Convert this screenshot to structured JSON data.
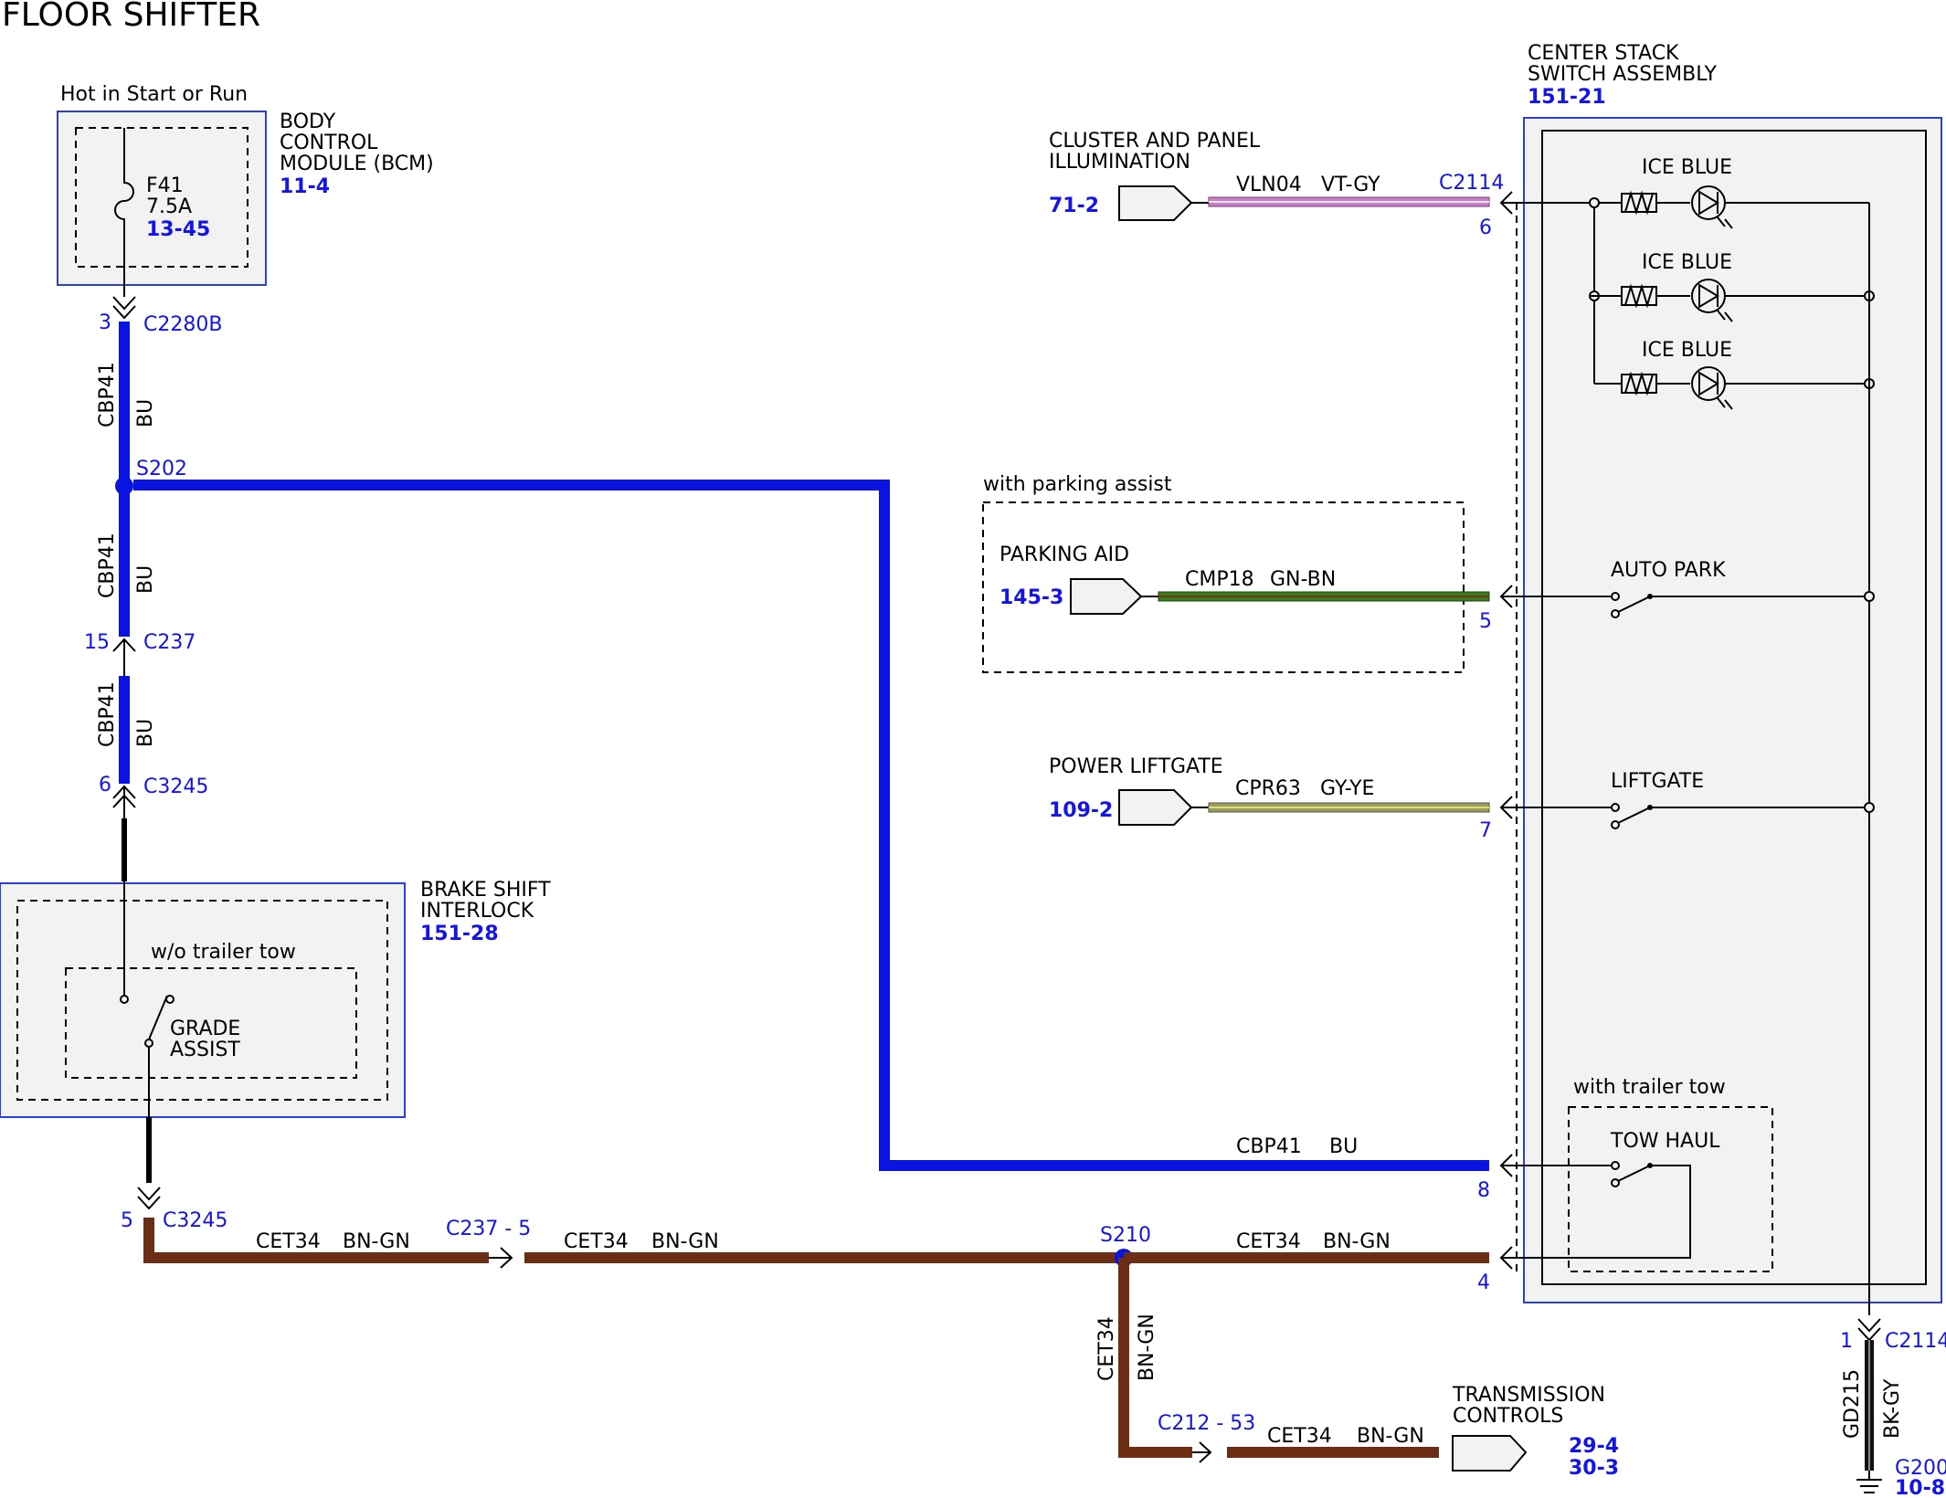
{
  "title": "FLOOR SHIFTER",
  "bcm": {
    "power_label": "Hot in Start or Run",
    "name_line1": "BODY",
    "name_line2": "CONTROL",
    "name_line3": "MODULE (BCM)",
    "ref": "11-4",
    "fuse": "F41",
    "fuse_rating": "7.5A",
    "fuse_ref": "13-45"
  },
  "connectors": {
    "c2280b_pin": "3",
    "c2280b": "C2280B",
    "s202": "S202",
    "c237_pin": "15",
    "c237": "C237",
    "c3245_pin_top": "6",
    "c3245_top": "C3245",
    "c3245_pin_bot": "5",
    "c3245_bot": "C3245",
    "c237_5": "C237 - 5",
    "s210": "S210",
    "c212": "C212 - 53",
    "c2114_top": "C2114",
    "c2114_bot": "C2114",
    "c2114_bot_pin": "1",
    "pin6": "6",
    "pin5": "5",
    "pin7": "7",
    "pin8": "8",
    "pin4": "4",
    "g200": "G200",
    "g200_ref": "10-8"
  },
  "wires": {
    "cbp41": "CBP41",
    "bu": "BU",
    "vln04": "VLN04",
    "vt_gy": "VT-GY",
    "cmp18": "CMP18",
    "gn_bn": "GN-BN",
    "cpr63": "CPR63",
    "gy_ye": "GY-YE",
    "cet34": "CET34",
    "bn_gn": "BN-GN",
    "gd215": "GD215",
    "bk_gy": "BK-GY"
  },
  "brake": {
    "line1": "BRAKE SHIFT",
    "line2": "INTERLOCK",
    "ref": "151-28",
    "option": "w/o trailer tow",
    "switch_line1": "GRADE",
    "switch_line2": "ASSIST"
  },
  "cluster": {
    "line1": "CLUSTER AND PANEL",
    "line2": "ILLUMINATION",
    "ref": "71-2"
  },
  "parking": {
    "option": "with parking assist",
    "name": "PARKING AID",
    "ref": "145-3"
  },
  "liftgate_mod": {
    "name": "POWER LIFTGATE",
    "ref": "109-2"
  },
  "trans": {
    "line1": "TRANSMISSION",
    "line2": "CONTROLS",
    "ref1": "29-4",
    "ref2": "30-3"
  },
  "css": {
    "line1": "CENTER STACK",
    "line2": "SWITCH ASSEMBLY",
    "ref": "151-21",
    "led1": "ICE BLUE",
    "led2": "ICE BLUE",
    "led3": "ICE BLUE",
    "auto_park": "AUTO PARK",
    "liftgate": "LIFTGATE",
    "trailer_option": "with trailer tow",
    "tow_haul": "TOW HAUL"
  }
}
